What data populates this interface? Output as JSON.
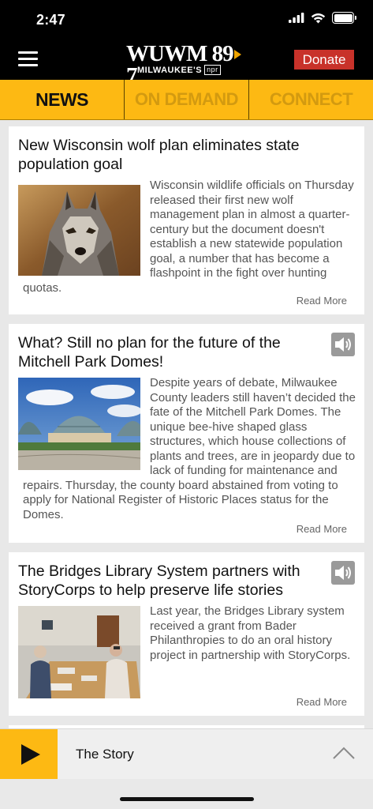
{
  "status_bar": {
    "time": "2:47"
  },
  "header": {
    "logo_main": "WUWM 89",
    "logo_decimal": "7",
    "logo_sub": "MILWAUKEE'S",
    "logo_npr": "npr",
    "donate_label": "Donate"
  },
  "tabs": [
    {
      "label": "NEWS",
      "active": true
    },
    {
      "label": "ON DEMAND",
      "active": false
    },
    {
      "label": "CONNECT",
      "active": false
    }
  ],
  "articles": [
    {
      "title": "New Wisconsin wolf plan eliminates state population goal",
      "excerpt": "Wisconsin wildlife officials on Thursday released their first new wolf management plan in almost a quarter-century but the document doesn't establish a new statewide population goal, a number that has become a flashpoint in the fight over hunting quotas.",
      "read_more": "Read More",
      "has_audio": false
    },
    {
      "title": "What? Still no plan for the future of the Mitchell Park Domes!",
      "excerpt": "Despite years of debate, Milwaukee County leaders still haven’t decided the fate of the Mitchell Park Domes. The unique bee-hive shaped glass structures, which house collections of plants and trees, are in jeopardy due to lack of funding for maintenance and repairs. Thursday, the county board abstained from voting to apply for National Register of Historic Places status for the Domes.",
      "read_more": "Read More",
      "has_audio": true
    },
    {
      "title": "The Bridges Library System partners with StoryCorps to help preserve life stories",
      "excerpt": "Last year, the Bridges Library system received a grant from Bader Philanthropies to do an oral history project in partnership with StoryCorps.",
      "read_more": "Read More",
      "has_audio": true
    }
  ],
  "player": {
    "now_playing": "The Story"
  },
  "colors": {
    "accent": "#fdb913",
    "donate": "#c8322a",
    "header_bg": "#000000"
  }
}
